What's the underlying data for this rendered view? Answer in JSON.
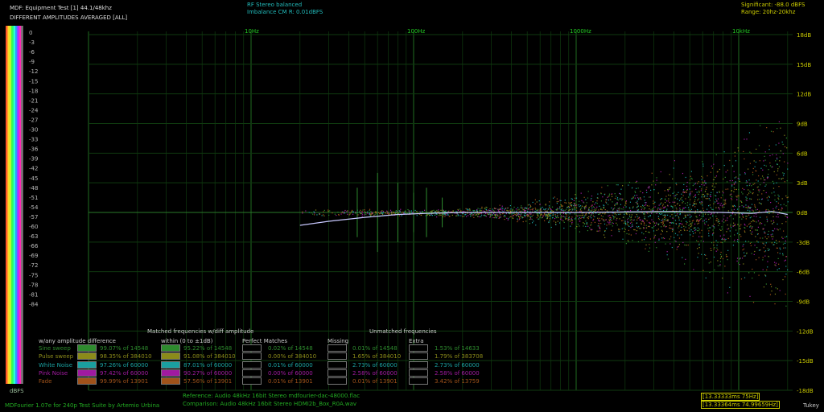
{
  "header": {
    "title": "MDF: Equipment Test [1] 44.1/48khz",
    "subtitle": "DIFFERENT AMPLITUDES AVERAGED [ALL]",
    "center_line1": "RF Stereo balanced",
    "center_line2": "Imbalance CM R: 0.01dBFS",
    "significant": "Significant: -88.0 dBFS",
    "range": "Range: 20hz-20khz"
  },
  "footer": {
    "credit": "MDFourier 1.07e for 240p Test Suite by Artemio Urbina",
    "reference": "Reference:   Audio    48kHz 16bit Stereo mdfourier-dac-48000.flac",
    "comparison": "Comparison: Audio    48kHz 16bit Stereo HDMI2b_Box_R0A.wav",
    "time1": "[13.33333ms 75Hz]",
    "time2": "[13.33364ms 74.99659Hz]",
    "window": "Tukey",
    "dbfs_label": "dBFS"
  },
  "chart_data": {
    "type": "scatter",
    "title": "DIFFERENT AMPLITUDES AVERAGED [ALL]",
    "xscale": "log",
    "xlim": [
      1,
      20000
    ],
    "ylim": [
      -18,
      18
    ],
    "x_ticks": [
      "10Hz",
      "100Hz",
      "1000Hz",
      "10kHz"
    ],
    "y_ticks": [
      "18dB",
      "15dB",
      "12dB",
      "9dB",
      "6dB",
      "3dB",
      "0dB",
      "-3dB",
      "-6dB",
      "-9dB",
      "-12dB",
      "-15dB",
      "-18dB"
    ],
    "y_tick_values": [
      18,
      15,
      12,
      9,
      6,
      3,
      0,
      -3,
      -6,
      -9,
      -12,
      -15,
      -18
    ],
    "colorbar_ticks": [
      "0",
      "-3",
      "-6",
      "-9",
      "-12",
      "-15",
      "-18",
      "-21",
      "-24",
      "-27",
      "-30",
      "-33",
      "-36",
      "-39",
      "-42",
      "-45",
      "-48",
      "-51",
      "-54",
      "-57",
      "-60",
      "-63",
      "-66",
      "-69",
      "-72",
      "-75",
      "-78",
      "-81",
      "-84"
    ],
    "series": [
      {
        "name": "Sine sweep",
        "color": "#2e8b2e"
      },
      {
        "name": "Pulse sweep",
        "color": "#8b8b1a"
      },
      {
        "name": "White Noise",
        "color": "#1aa0a0"
      },
      {
        "name": "Pink Noise",
        "color": "#a01aa0"
      },
      {
        "name": "Fade",
        "color": "#a0521a"
      }
    ],
    "average_curve": {
      "x": [
        20,
        30,
        50,
        80,
        120,
        200,
        400,
        1000,
        2000,
        4000,
        8000,
        12000,
        16000,
        20000
      ],
      "y": [
        -1.3,
        -0.9,
        -0.5,
        -0.2,
        -0.1,
        0,
        0,
        0,
        0.05,
        0.1,
        0,
        -0.1,
        0.1,
        -0.2
      ]
    },
    "grid": true
  },
  "legend": {
    "heading_any": "w/any amplitude difference",
    "heading_matched": "Matched frequencies w/diff amplitude",
    "heading_within": "within (0 to ±1dB)",
    "heading_perfect": "Perfect Matches",
    "heading_unmatched": "Unmatched frequencies",
    "heading_missing": "Missing",
    "heading_extra": "Extra",
    "rows": [
      {
        "name": "Sine sweep",
        "color": "#2e8b2e",
        "any": "99.07% of 14548",
        "within": "95.22% of 14548",
        "perfect": "0.02% of 14548",
        "missing": "0.01% of 14548",
        "extra": "1.53% of 14633"
      },
      {
        "name": "Pulse sweep",
        "color": "#8b8b1a",
        "any": "98.35% of 384010",
        "within": "91.08% of 384010",
        "perfect": "0.00% of 384010",
        "missing": "1.65% of 384010",
        "extra": "1.79% of 383708"
      },
      {
        "name": "White Noise",
        "color": "#1aa0a0",
        "any": "97.26% of 60000",
        "within": "87.01% of 60000",
        "perfect": "0.01% of 60000",
        "missing": "2.73% of 60000",
        "extra": "2.73% of 60000"
      },
      {
        "name": "Pink Noise",
        "color": "#a01aa0",
        "any": "97.42% of 60000",
        "within": "90.27% of 60000",
        "perfect": "0.00% of 60000",
        "missing": "2.58% of 60000",
        "extra": "2.58% of 60000"
      },
      {
        "name": "Fade",
        "color": "#a0521a",
        "any": "99.99% of 13901",
        "within": "57.56% of 13901",
        "perfect": "0.01% of 13901",
        "missing": "0.01% of 13901",
        "extra": "3.42% of 13759"
      }
    ]
  }
}
